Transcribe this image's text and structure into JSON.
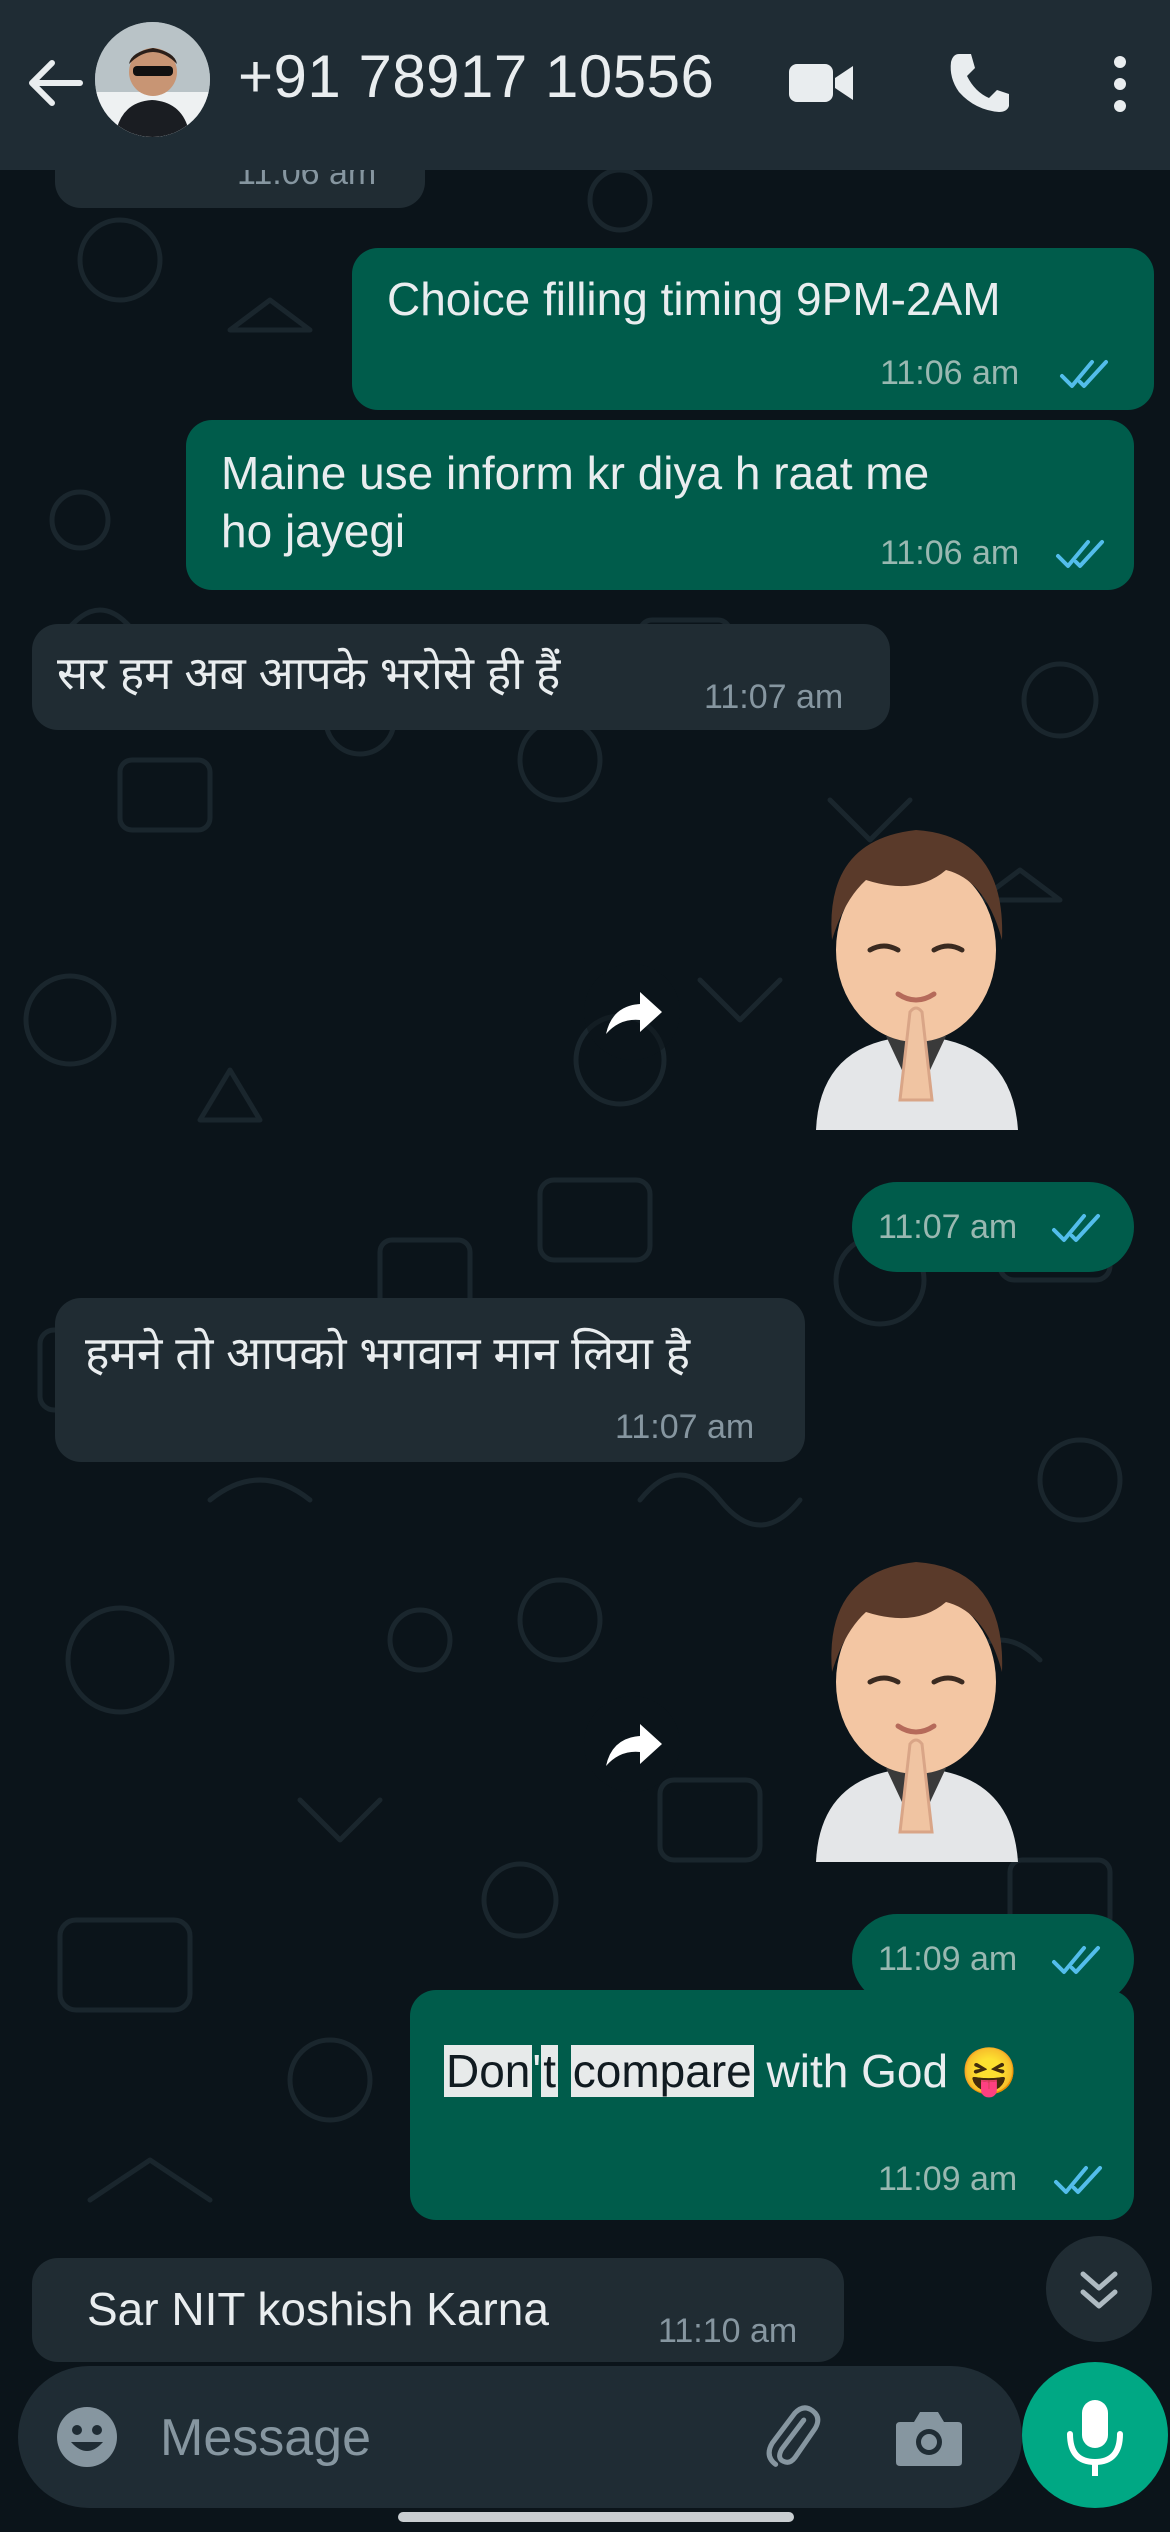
{
  "header": {
    "contact_name": "+91 78917 10556"
  },
  "messages": [
    {
      "id": "m0",
      "direction": "in",
      "text": "",
      "time": "11:06 am"
    },
    {
      "id": "m1",
      "direction": "out",
      "text": "Choice filling timing 9PM-2AM",
      "time": "11:06 am",
      "status": "read"
    },
    {
      "id": "m2",
      "direction": "out",
      "lines": [
        "Maine use inform kr diya h raat me",
        "ho jayegi"
      ],
      "time": "11:06 am",
      "status": "read"
    },
    {
      "id": "m3",
      "direction": "in",
      "text": "सर हम अब आपके भरोसे ही हैं",
      "time": "11:07 am"
    },
    {
      "id": "m4",
      "direction": "out",
      "type": "sticker",
      "time": "11:07 am",
      "status": "read"
    },
    {
      "id": "m5",
      "direction": "in",
      "text": "हमने तो आपको भगवान मान लिया है",
      "time": "11:07 am"
    },
    {
      "id": "m6",
      "direction": "out",
      "type": "sticker",
      "time": "11:09 am",
      "status": "read"
    },
    {
      "id": "m7",
      "direction": "out",
      "parts": [
        "Don",
        "'",
        "t",
        " ",
        "compare",
        " with God ",
        "😝"
      ],
      "time": "11:09 am",
      "status": "read"
    },
    {
      "id": "m8",
      "direction": "in",
      "text": "Sar NIT koshish Karna",
      "time": "11:10 am"
    }
  ],
  "composer": {
    "placeholder": "Message"
  },
  "icons": {
    "back": "arrow-left-icon",
    "video": "video-call-icon",
    "call": "phone-icon",
    "menu": "more-vertical-icon",
    "emoji": "emoji-icon",
    "attach": "paperclip-icon",
    "camera": "camera-icon",
    "mic": "microphone-icon",
    "forward": "forward-icon",
    "scroll": "double-chevron-down-icon"
  },
  "colors": {
    "header_bg": "#1f2c34",
    "chat_bg": "#0b141a",
    "outgoing_bubble": "#005c4b",
    "incoming_bubble": "#202c33",
    "read_tick": "#53bdeb",
    "accent": "#00a884"
  }
}
